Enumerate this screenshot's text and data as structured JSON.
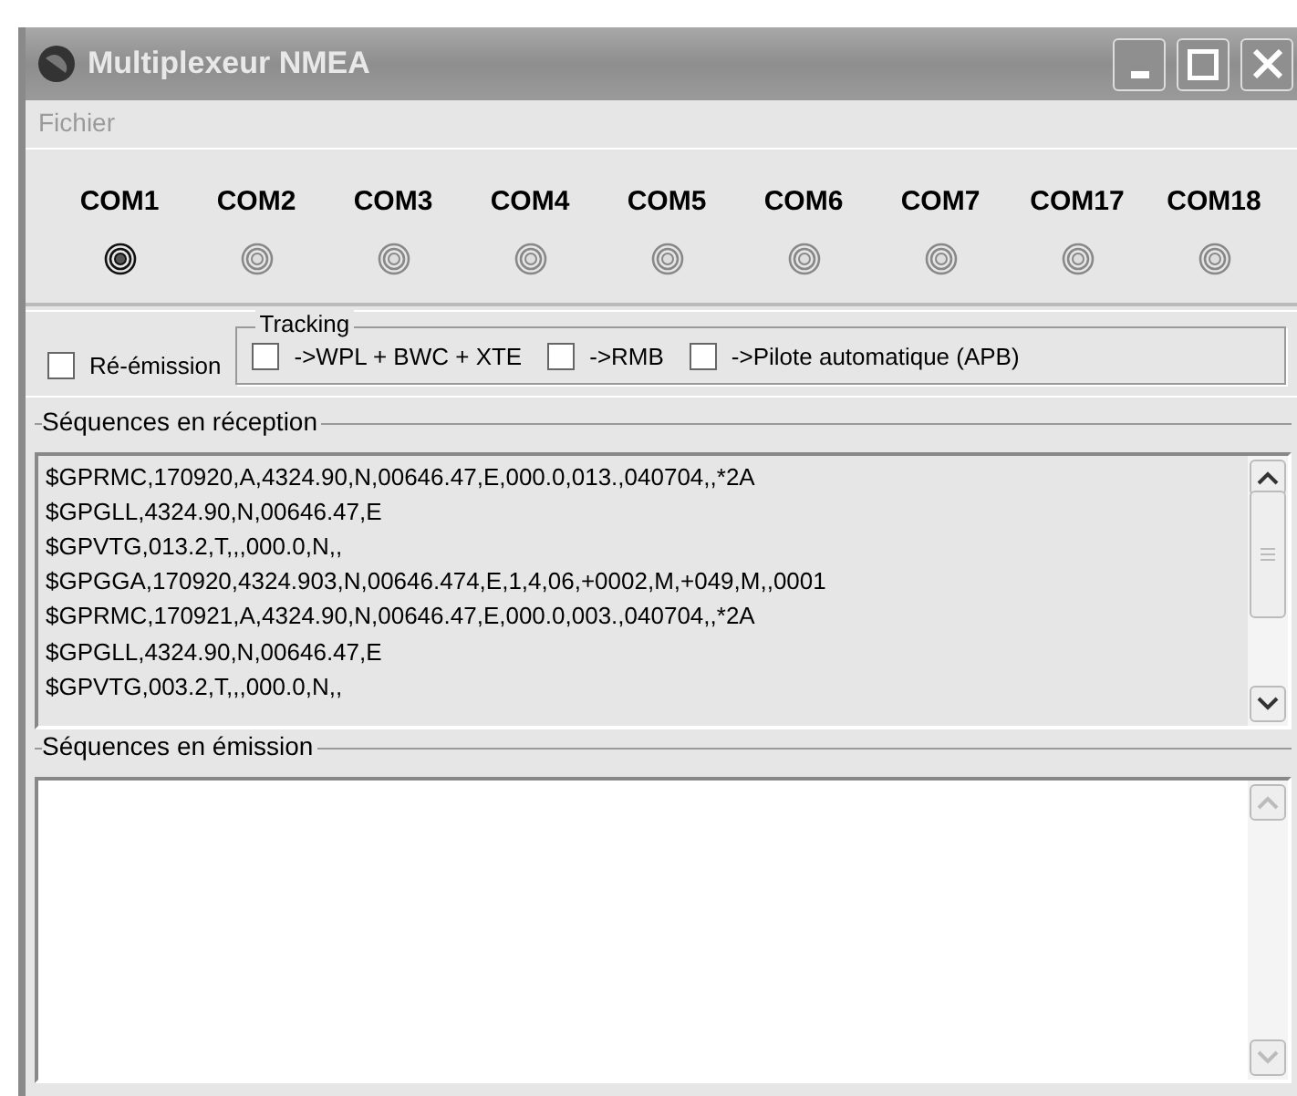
{
  "window": {
    "title": "Multiplexeur NMEA"
  },
  "menu": [
    {
      "label": "Fichier",
      "disabled": true
    }
  ],
  "ports": [
    {
      "label": "COM1",
      "active": true
    },
    {
      "label": "COM2",
      "active": false
    },
    {
      "label": "COM3",
      "active": false
    },
    {
      "label": "COM4",
      "active": false
    },
    {
      "label": "COM5",
      "active": false
    },
    {
      "label": "COM6",
      "active": false
    },
    {
      "label": "COM7",
      "active": false
    },
    {
      "label": "COM17",
      "active": false
    },
    {
      "label": "COM18",
      "active": false
    }
  ],
  "reemission": {
    "label": "Ré-émission",
    "checked": false
  },
  "tracking": {
    "title": "Tracking",
    "options": [
      {
        "label": "->WPL + BWC + XTE",
        "checked": false
      },
      {
        "label": "->RMB",
        "checked": false
      },
      {
        "label": "->Pilote automatique (APB)",
        "checked": false
      }
    ]
  },
  "reception": {
    "title": "Séquences en réception",
    "lines": [
      "$GPRMC,170920,A,4324.90,N,00646.47,E,000.0,013.,040704,,*2A",
      "$GPGLL,4324.90,N,00646.47,E",
      "$GPVTG,013.2,T,,,000.0,N,,",
      "$GPGGA,170920,4324.903,N,00646.474,E,1,4,06,+0002,M,+049,M,,0001",
      "$GPRMC,170921,A,4324.90,N,00646.47,E,000.0,003.,040704,,*2A",
      "$GPGLL,4324.90,N,00646.47,E",
      "$GPVTG,003.2,T,,,000.0,N,,"
    ]
  },
  "emission": {
    "title": "Séquences en émission"
  }
}
